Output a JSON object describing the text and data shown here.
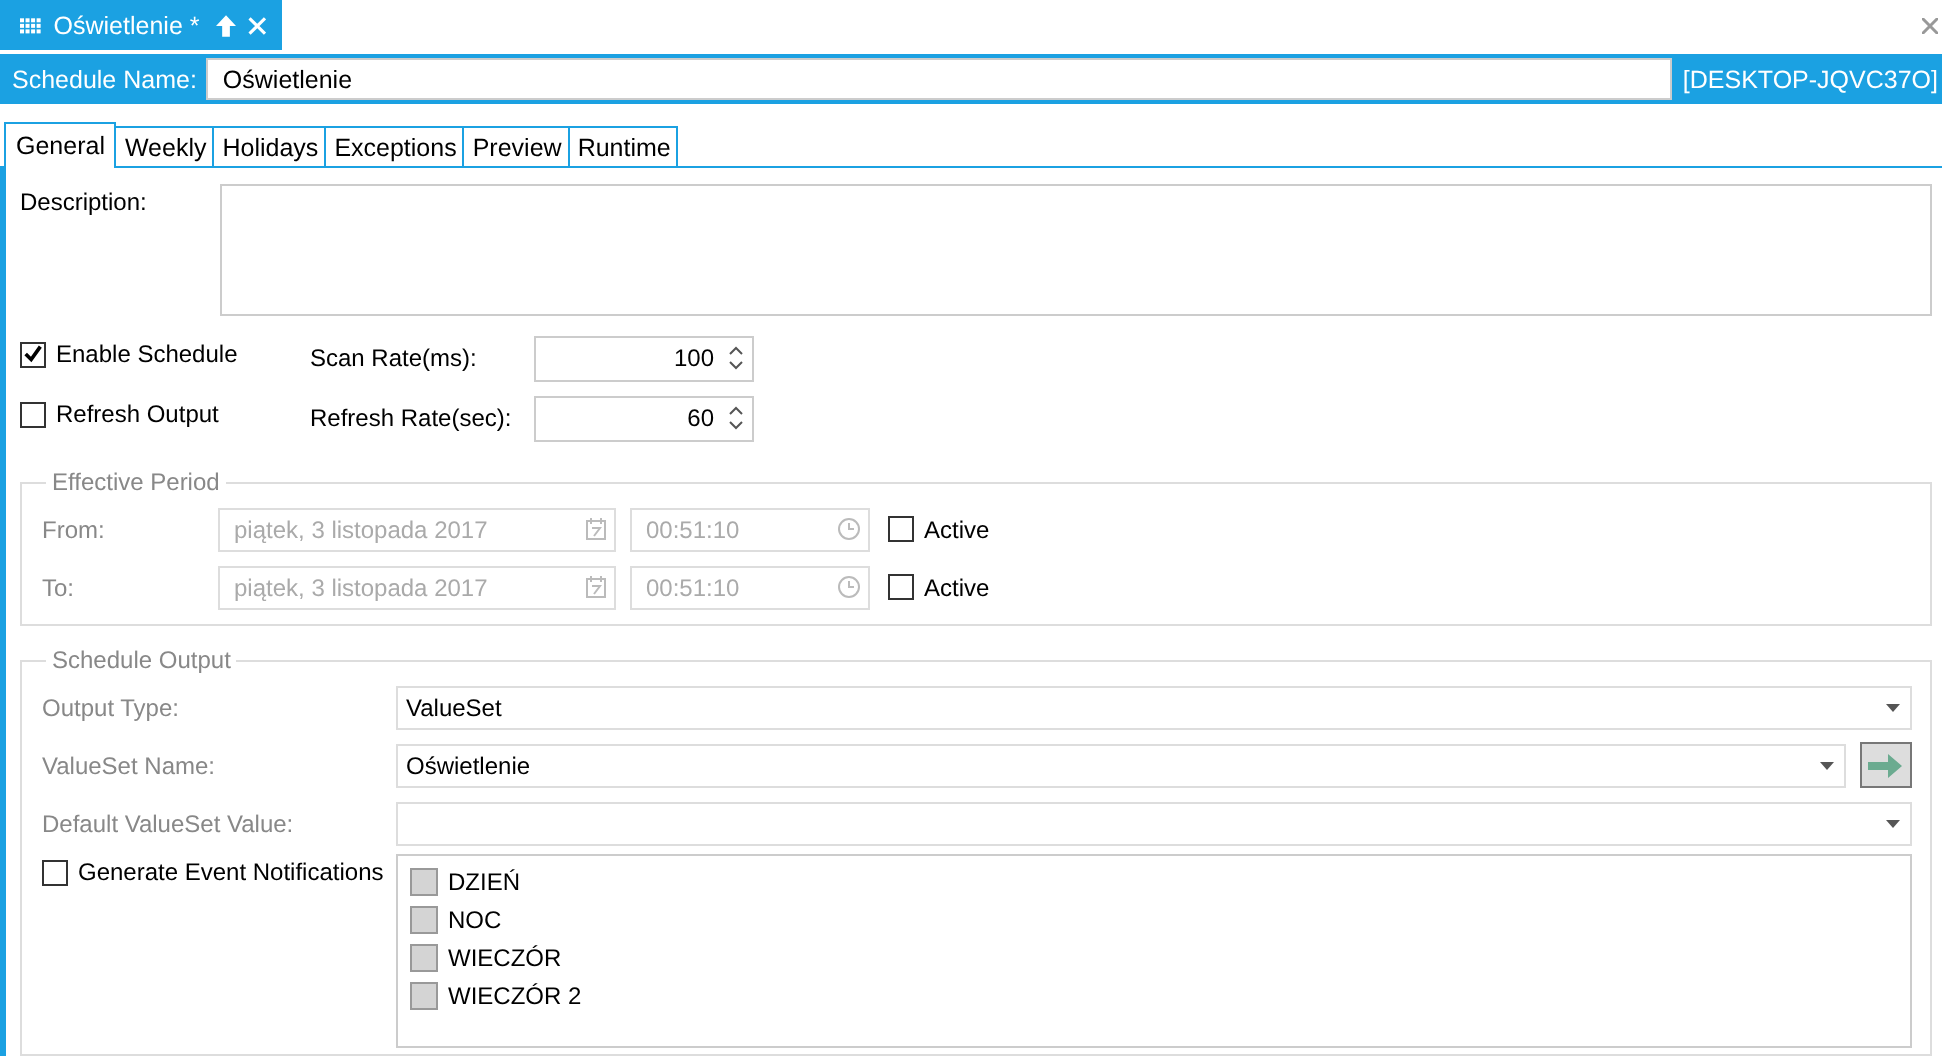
{
  "document_tab": {
    "title": "Oświetlenie *"
  },
  "schedule_name": {
    "label": "Schedule Name:",
    "value": "Oświetlenie",
    "host": "[DESKTOP-JQVC37O]"
  },
  "tabs": [
    {
      "label": "General",
      "selected": true
    },
    {
      "label": "Weekly",
      "selected": false
    },
    {
      "label": "Holidays",
      "selected": false
    },
    {
      "label": "Exceptions",
      "selected": false
    },
    {
      "label": "Preview",
      "selected": false
    },
    {
      "label": "Runtime",
      "selected": false
    }
  ],
  "description": {
    "label": "Description:"
  },
  "options": [
    {
      "label": "Enable Schedule",
      "checked": true
    },
    {
      "label": "Refresh Output",
      "checked": false
    }
  ],
  "rates": [
    {
      "label": "Scan Rate(ms):",
      "value": "100"
    },
    {
      "label": "Refresh Rate(sec):",
      "value": "60"
    }
  ],
  "effective_period": {
    "legend": "Effective Period",
    "disabled": true,
    "rows": [
      {
        "label": "From:",
        "date": "piątek, 3 listopada 2017",
        "time": "00:51:10",
        "active_label": "Active",
        "active": false
      },
      {
        "label": "To:",
        "date": "piątek, 3 listopada 2017",
        "time": "00:51:10",
        "active_label": "Active",
        "active": false
      }
    ]
  },
  "schedule_output": {
    "legend": "Schedule Output",
    "fields": [
      {
        "label": "Output Type:",
        "kind": "dropdown",
        "value": "ValueSet"
      },
      {
        "label": "ValueSet Name:",
        "kind": "dropdown_button",
        "value": "Oświetlenie"
      },
      {
        "label": "Default ValueSet Value:",
        "kind": "dropdown"
      }
    ],
    "notifications": {
      "label": "Generate Event Notifications",
      "checked": false
    },
    "values": [
      {
        "label": "DZIEŃ",
        "checked": false
      },
      {
        "label": "NOC",
        "checked": false
      },
      {
        "label": "WIECZÓR",
        "checked": false
      },
      {
        "label": "WIECZÓR 2",
        "checked": false
      }
    ]
  }
}
